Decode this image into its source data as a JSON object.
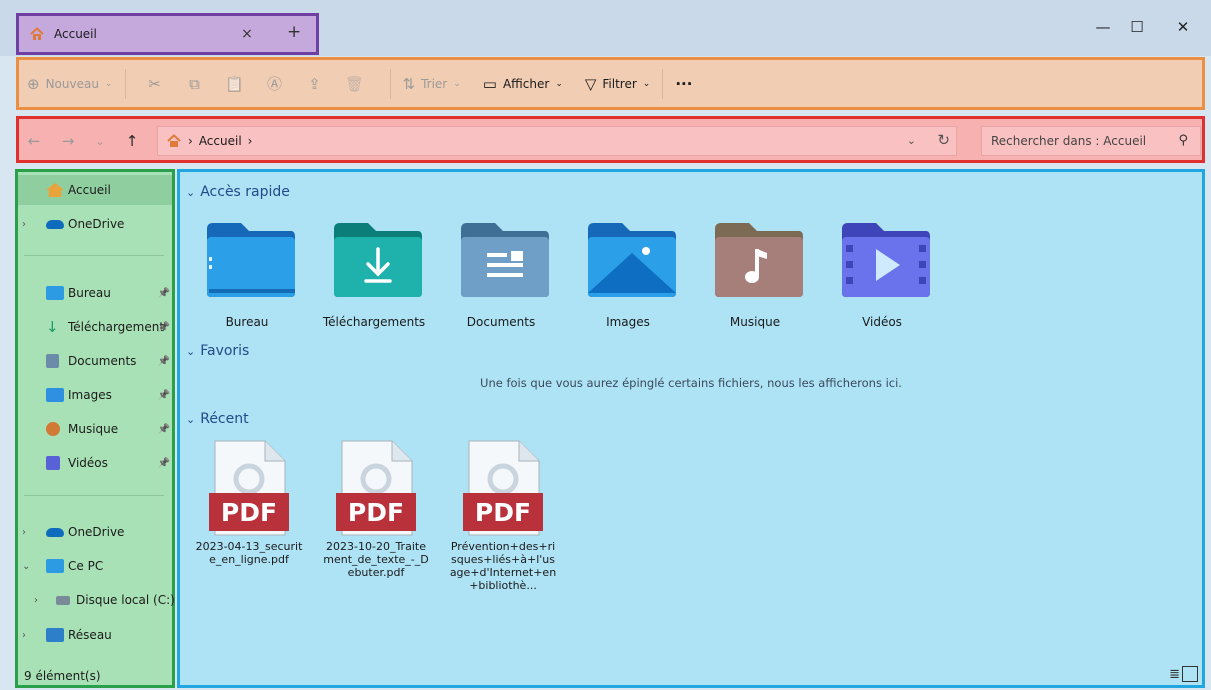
{
  "window": {
    "tab_title": "Accueil",
    "tab_close": "×",
    "new_tab": "+",
    "minimize": "—",
    "maximize": "☐",
    "close": "✕"
  },
  "toolbar": {
    "new": {
      "label": "Nouveau",
      "glyph": "⊕",
      "caret": "⌄"
    },
    "cut_glyph": "✂",
    "copy_glyph": "⧉",
    "paste_glyph": "📋",
    "rename_glyph": "Ⓐ",
    "share_glyph": "⇪",
    "delete_glyph": "🗑",
    "sort": {
      "label": "Trier",
      "glyph": "⇅",
      "caret": "⌄"
    },
    "view": {
      "label": "Afficher",
      "glyph": "▭",
      "caret": "⌄"
    },
    "filter": {
      "label": "Filtrer",
      "glyph": "▽",
      "caret": "⌄"
    },
    "more": "···"
  },
  "nav": {
    "back": "←",
    "forward": "→",
    "recent": "⌄",
    "up": "↑",
    "breadcrumb": "Accueil",
    "breadcrumb_sep": "›",
    "dropdown": "⌄",
    "refresh": "↻",
    "search_placeholder": "Rechercher dans : Accueil",
    "search_glyph": "⚲"
  },
  "sidebar": {
    "items": [
      {
        "label": "Accueil",
        "icon": "home-icon",
        "color": "#e9a33a",
        "pinned": false
      },
      {
        "label": "OneDrive",
        "icon": "cloud-icon",
        "color": "#0f6cbd",
        "pinned": false
      },
      {
        "label": "Bureau",
        "icon": "desktop-icon",
        "color": "#2c9be3",
        "pinned": true
      },
      {
        "label": "Téléchargement",
        "icon": "download-icon",
        "color": "#1a9a6a",
        "pinned": true
      },
      {
        "label": "Documents",
        "icon": "documents-icon",
        "color": "#6b8ca8",
        "pinned": true
      },
      {
        "label": "Images",
        "icon": "images-icon",
        "color": "#2f8fe0",
        "pinned": true
      },
      {
        "label": "Musique",
        "icon": "music-icon",
        "color": "#d07a36",
        "pinned": true
      },
      {
        "label": "Vidéos",
        "icon": "videos-icon",
        "color": "#5862d6",
        "pinned": true
      },
      {
        "label": "OneDrive",
        "icon": "cloud-icon",
        "color": "#0f6cbd",
        "pinned": false
      },
      {
        "label": "Ce PC",
        "icon": "pc-icon",
        "color": "#2c9be3",
        "pinned": false
      },
      {
        "label": "Disque local (C:)",
        "icon": "drive-icon",
        "color": "#7a8a99",
        "pinned": false
      },
      {
        "label": "Réseau",
        "icon": "network-icon",
        "color": "#2c7fc8",
        "pinned": false
      }
    ],
    "pin_glyph": "📌",
    "expand_glyph": "›",
    "expanded_glyph": "⌄",
    "item_count": "9 élément(s)"
  },
  "content": {
    "quick_access_title": "Accès rapide",
    "favorites_title": "Favoris",
    "recent_title": "Récent",
    "section_chevron": "⌄",
    "folders": [
      {
        "label": "Bureau",
        "icon": "desktop-folder-icon",
        "color": "#1f8ad8"
      },
      {
        "label": "Téléchargements",
        "icon": "downloads-folder-icon",
        "color": "#11a09a"
      },
      {
        "label": "Documents",
        "icon": "documents-folder-icon",
        "color": "#5a8fb8"
      },
      {
        "label": "Images",
        "icon": "images-folder-icon",
        "color": "#1f8ad8"
      },
      {
        "label": "Musique",
        "icon": "music-folder-icon",
        "color": "#a57a5e"
      },
      {
        "label": "Vidéos",
        "icon": "videos-folder-icon",
        "color": "#5a62e0"
      }
    ],
    "favorites_empty": "Une fois que vous aurez épinglé certains fichiers, nous les afficherons ici.",
    "recent_files": [
      {
        "name": "2023-04-13_securite_en_ligne.pdf",
        "badge": "PDF"
      },
      {
        "name": "2023-10-20_Traitement_de_texte_-_Debuter.pdf",
        "badge": "PDF"
      },
      {
        "name": "Prévention+des+risques+liés+à+l'usage+d'Internet+en+bibliothè...",
        "badge": "PDF"
      }
    ],
    "view_details_glyph": "≣"
  }
}
